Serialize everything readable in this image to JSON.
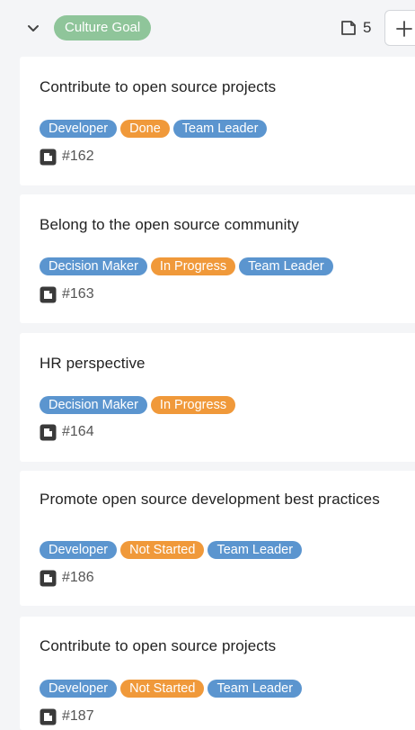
{
  "column": {
    "group_label": "Culture Goal",
    "card_count": "5",
    "add_label": "+"
  },
  "colors": {
    "group_pill": "#8fc59a",
    "role_tag": "#5b95cf",
    "status_tag": "#f0993a",
    "background": "#f4f5f7"
  },
  "cards": [
    {
      "title": "Contribute to open source projects",
      "tags": [
        "Developer",
        "Done",
        "Team Leader"
      ],
      "issue": "#162"
    },
    {
      "title": "Belong to the open source community",
      "tags": [
        "Decision Maker",
        "In Progress",
        "Team Leader"
      ],
      "issue": "#163"
    },
    {
      "title": "HR perspective",
      "tags": [
        "Decision Maker",
        "In Progress"
      ],
      "issue": "#164"
    },
    {
      "title": "Promote open source development best practices",
      "tags": [
        "Developer",
        "Not Started",
        "Team Leader"
      ],
      "issue": "#186"
    },
    {
      "title": "Contribute to open source projects",
      "tags": [
        "Developer",
        "Not Started",
        "Team Leader"
      ],
      "issue": "#187"
    }
  ]
}
